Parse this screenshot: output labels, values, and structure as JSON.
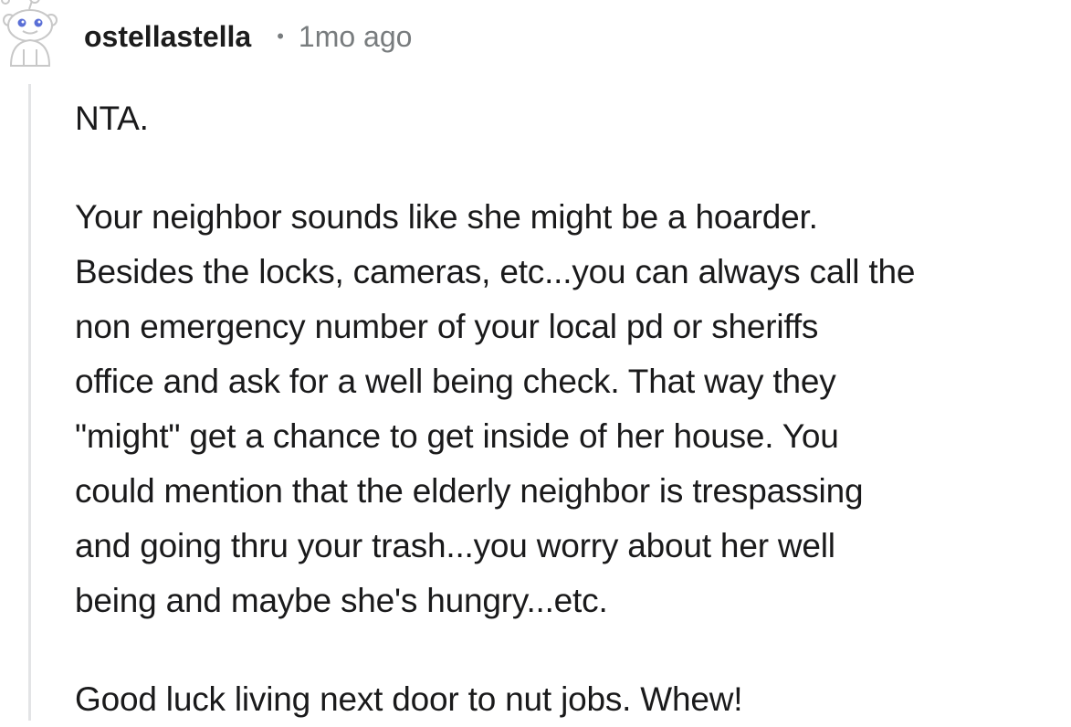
{
  "comment": {
    "author": "ostellastella",
    "separator": "•",
    "timestamp": "1mo ago",
    "paragraphs": [
      "NTA.",
      "Your neighbor sounds like she might be a hoarder.\nBesides the locks, cameras, etc...you can always call the\nnon emergency number of your local pd or sheriffs\noffice and ask for a well being check. That way they\n\"might\" get a chance to get inside of her house. You\ncould mention that the elderly neighbor is trespassing\nand going thru your trash...you worry about her well\nbeing and maybe she's hungry...etc.",
      "Good luck living next door to nut jobs. Whew!"
    ]
  },
  "icons": {
    "avatar": "reddit-snoo-avatar-icon"
  },
  "colors": {
    "text": "#1a1a1b",
    "meta": "#787c7e",
    "thread_line": "#e3e4e6",
    "avatar_eye": "#5a6fd6"
  }
}
